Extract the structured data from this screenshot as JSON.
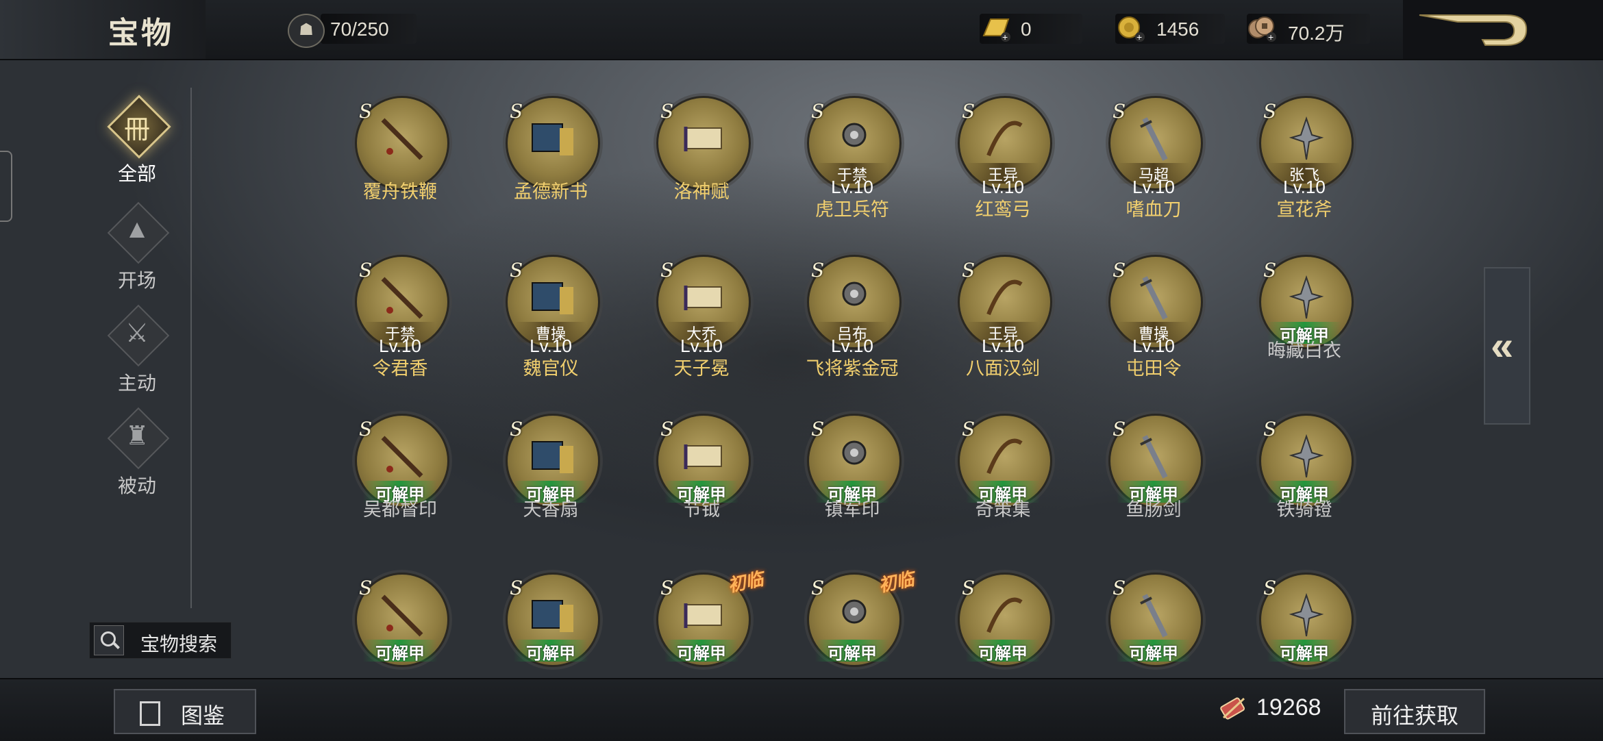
{
  "header": {
    "title": "宝物",
    "capacity": "70/250",
    "currencies": [
      {
        "icon": "gold-bar-icon",
        "value": "0"
      },
      {
        "icon": "gold-coin-icon",
        "value": "1456"
      },
      {
        "icon": "copper-coin-icon",
        "value": "70.2万"
      }
    ]
  },
  "sidebar": {
    "items": [
      {
        "label": "全部",
        "icon": "all-treasure-icon",
        "active": true
      },
      {
        "label": "开场",
        "icon": "opening-icon",
        "active": false
      },
      {
        "label": "主动",
        "icon": "active-skill-icon",
        "active": false
      },
      {
        "label": "被动",
        "icon": "passive-skill-icon",
        "active": false
      }
    ],
    "search_label": "宝物搜索"
  },
  "grid": {
    "rows": [
      [
        {
          "grade": "S",
          "owner": "",
          "level": "",
          "name": "覆舟铁鞭",
          "status": "owned"
        },
        {
          "grade": "S",
          "owner": "",
          "level": "",
          "name": "孟德新书",
          "status": "owned"
        },
        {
          "grade": "S",
          "owner": "",
          "level": "",
          "name": "洛神赋",
          "status": "owned"
        },
        {
          "grade": "S",
          "owner": "于禁",
          "level": "Lv.10",
          "name": "虎卫兵符",
          "status": "equipped"
        },
        {
          "grade": "S",
          "owner": "王异",
          "level": "Lv.10",
          "name": "红鸾弓",
          "status": "equipped"
        },
        {
          "grade": "S",
          "owner": "马超",
          "level": "Lv.10",
          "name": "嗜血刀",
          "status": "equipped"
        },
        {
          "grade": "S",
          "owner": "张飞",
          "level": "Lv.10",
          "name": "宣花斧",
          "status": "equipped"
        }
      ],
      [
        {
          "grade": "S",
          "owner": "于禁",
          "level": "Lv.10",
          "name": "令君香",
          "status": "equipped"
        },
        {
          "grade": "S",
          "owner": "曹操",
          "level": "Lv.10",
          "name": "魏官仪",
          "status": "equipped"
        },
        {
          "grade": "S",
          "owner": "大乔",
          "level": "Lv.10",
          "name": "天子冕",
          "status": "equipped"
        },
        {
          "grade": "S",
          "owner": "吕布",
          "level": "Lv.10",
          "name": "飞将紫金冠",
          "status": "equipped"
        },
        {
          "grade": "S",
          "owner": "王异",
          "level": "Lv.10",
          "name": "八面汉剑",
          "status": "equipped"
        },
        {
          "grade": "S",
          "owner": "曹操",
          "level": "Lv.10",
          "name": "屯田令",
          "status": "equipped"
        },
        {
          "grade": "S",
          "owner": "",
          "level": "",
          "name": "晦藏白衣",
          "status": "unlockable",
          "tag": "可解甲"
        }
      ],
      [
        {
          "grade": "S",
          "name": "吴都督印",
          "status": "unlockable",
          "tag": "可解甲"
        },
        {
          "grade": "S",
          "name": "天香扇",
          "status": "unlockable",
          "tag": "可解甲"
        },
        {
          "grade": "S",
          "name": "节钺",
          "status": "unlockable",
          "tag": "可解甲"
        },
        {
          "grade": "S",
          "name": "镇军印",
          "status": "unlockable",
          "tag": "可解甲"
        },
        {
          "grade": "S",
          "name": "奇策集",
          "status": "unlockable",
          "tag": "可解甲"
        },
        {
          "grade": "S",
          "name": "鱼肠剑",
          "status": "unlockable",
          "tag": "可解甲"
        },
        {
          "grade": "S",
          "name": "铁骑镫",
          "status": "unlockable",
          "tag": "可解甲"
        }
      ],
      [
        {
          "grade": "S",
          "name": "",
          "status": "unlockable",
          "tag": "可解甲"
        },
        {
          "grade": "S",
          "name": "",
          "status": "unlockable",
          "tag": "可解甲"
        },
        {
          "grade": "S",
          "name": "",
          "status": "unlockable",
          "tag": "可解甲",
          "badge": "初临"
        },
        {
          "grade": "S",
          "name": "",
          "status": "unlockable",
          "tag": "可解甲",
          "badge": "初临"
        },
        {
          "grade": "S",
          "name": "",
          "status": "unlockable",
          "tag": "可解甲"
        },
        {
          "grade": "S",
          "name": "",
          "status": "unlockable",
          "tag": "可解甲"
        },
        {
          "grade": "S",
          "name": "",
          "status": "unlockable",
          "tag": "可解甲"
        }
      ]
    ]
  },
  "bottom": {
    "tujian_label": "图鉴",
    "material_count": "19268",
    "goto_label": "前往获取"
  },
  "colors": {
    "gold_text": "#f1cf6e",
    "unlock_green": "#1c963c",
    "circle_gold": "#b8a464"
  }
}
